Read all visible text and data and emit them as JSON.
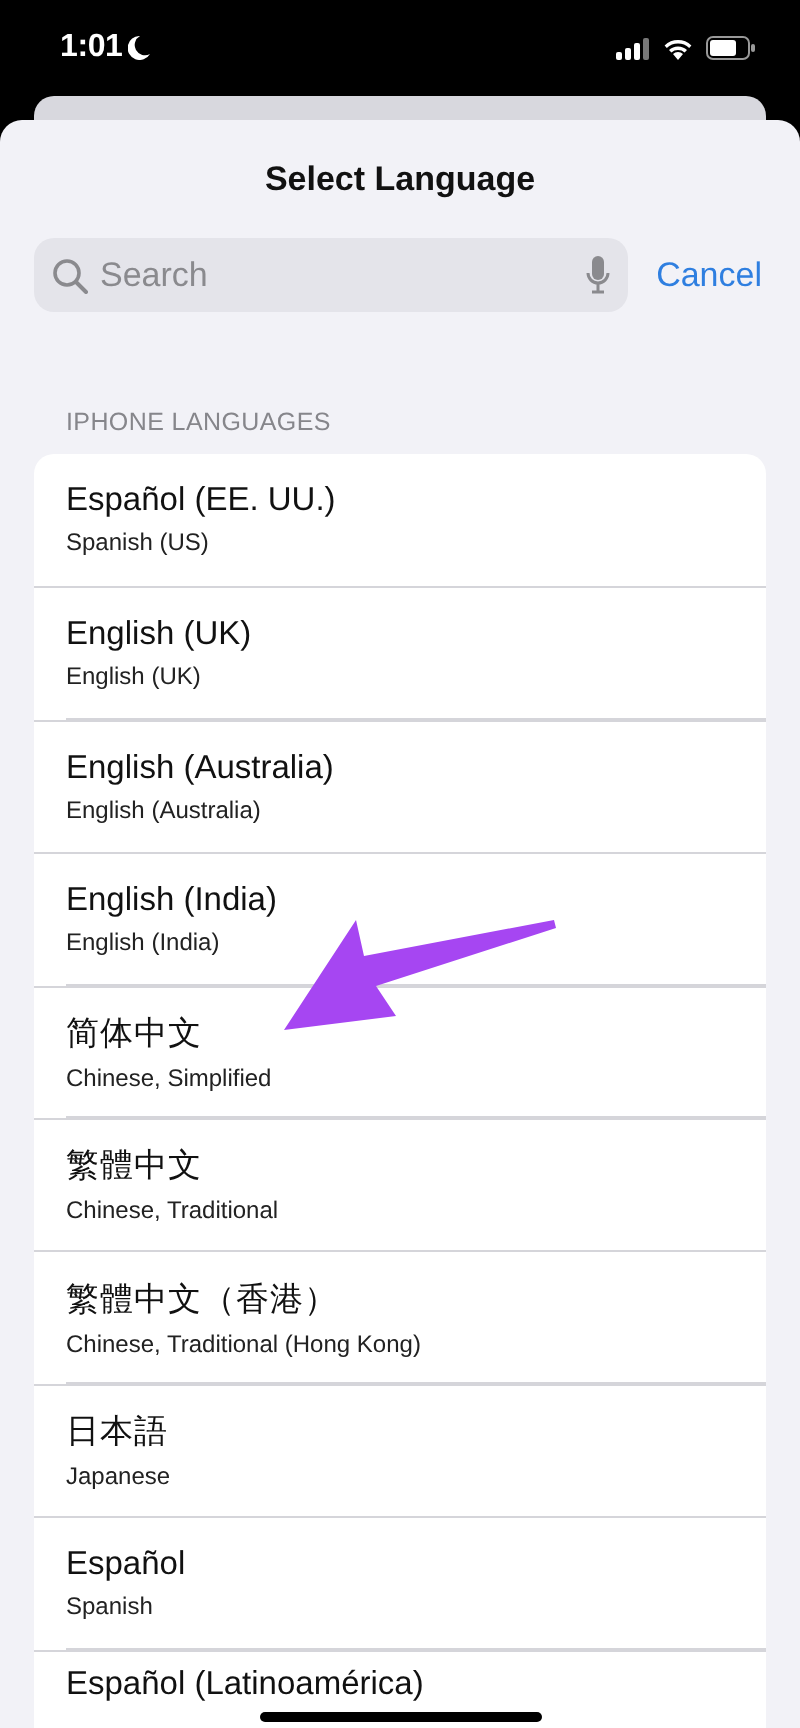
{
  "status_bar": {
    "time": "1:01"
  },
  "title": "Select Language",
  "search": {
    "placeholder": "Search"
  },
  "cancel": "Cancel",
  "section_header": "IPHONE LANGUAGES",
  "languages": [
    {
      "name": "Español (EE. UU.)",
      "subtitle": "Spanish (US)"
    },
    {
      "name": "English (UK)",
      "subtitle": "English (UK)"
    },
    {
      "name": "English (Australia)",
      "subtitle": "English (Australia)"
    },
    {
      "name": "English (India)",
      "subtitle": "English (India)"
    },
    {
      "name": "简体中文",
      "subtitle": "Chinese, Simplified"
    },
    {
      "name": "繁體中文",
      "subtitle": "Chinese, Traditional"
    },
    {
      "name": "繁體中文（香港）",
      "subtitle": "Chinese, Traditional (Hong Kong)"
    },
    {
      "name": "日本語",
      "subtitle": "Japanese"
    },
    {
      "name": "Español",
      "subtitle": "Spanish"
    },
    {
      "name": "Español (Latinoamérica)"
    }
  ]
}
